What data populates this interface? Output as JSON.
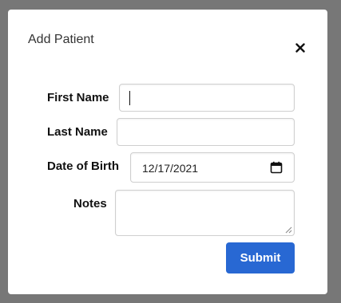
{
  "dialog": {
    "title": "Add Patient",
    "close_icon": "close-x-icon"
  },
  "form": {
    "first_name": {
      "label": "First Name",
      "value": "",
      "placeholder": ""
    },
    "last_name": {
      "label": "Last Name",
      "value": "",
      "placeholder": ""
    },
    "dob": {
      "label": "Date of Birth",
      "value": "12/17/2021",
      "icon": "calendar-icon"
    },
    "notes": {
      "label": "Notes",
      "value": "",
      "placeholder": ""
    },
    "submit_label": "Submit"
  },
  "colors": {
    "backdrop": "#777777",
    "dialog_bg": "#ffffff",
    "primary_button": "#2868d3",
    "border": "#cfcfcf"
  }
}
